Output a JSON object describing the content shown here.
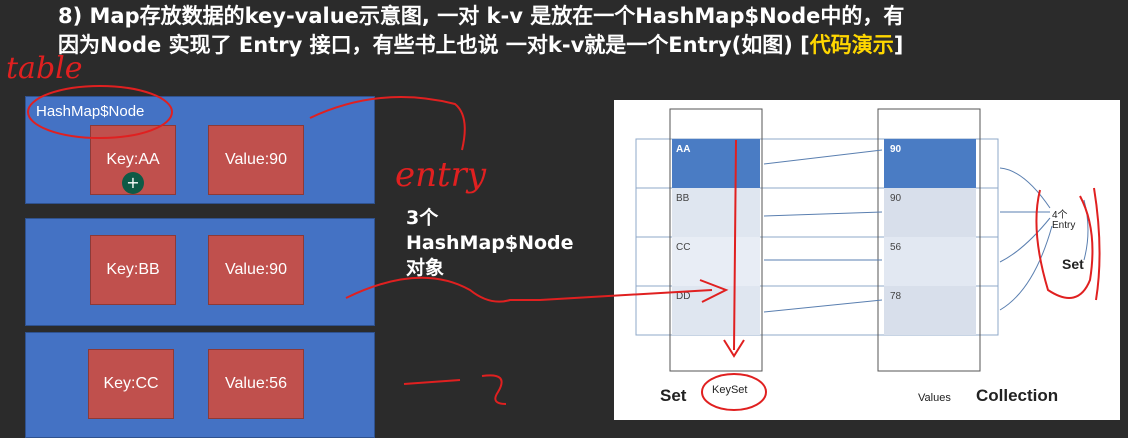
{
  "heading": {
    "line1": "8) Map存放数据的key-value示意图, 一对 k-v 是放在一个HashMap$Node中的，有",
    "line2_prefix": "因为Node 实现了  Entry 接口，有些书上也说 一对k-v就是一个Entry(如图) [",
    "line2_link": "代码演示",
    "line2_suffix": "]"
  },
  "nodes": {
    "title": "HashMap$Node",
    "items": [
      {
        "key": "Key:AA",
        "value": "Value:90"
      },
      {
        "key": "Key:BB",
        "value": "Value:90"
      },
      {
        "key": "Key:CC",
        "value": "Value:56"
      }
    ]
  },
  "note": {
    "line1": "3个",
    "line2": "HashMap$Node",
    "line3": "对象"
  },
  "diagram": {
    "keys": [
      "AA",
      "BB",
      "CC",
      "DD"
    ],
    "values": [
      "90",
      "90",
      "56",
      "78"
    ],
    "entry_label_1": "4个",
    "entry_label_2": "Entry",
    "set_right": "Set",
    "set_bottom": "Set",
    "keyset": "KeySet",
    "values_label": "Values",
    "collection": "Collection"
  },
  "annotations": {
    "table": "table",
    "entry": "entry"
  },
  "colors": {
    "background": "#2b2b2b",
    "node_blue": "#4472c4",
    "cell_red": "#c0504d",
    "highlight_yellow": "#ffd700",
    "ink_red": "#e02020",
    "selected_row": "#4a7cc4"
  }
}
